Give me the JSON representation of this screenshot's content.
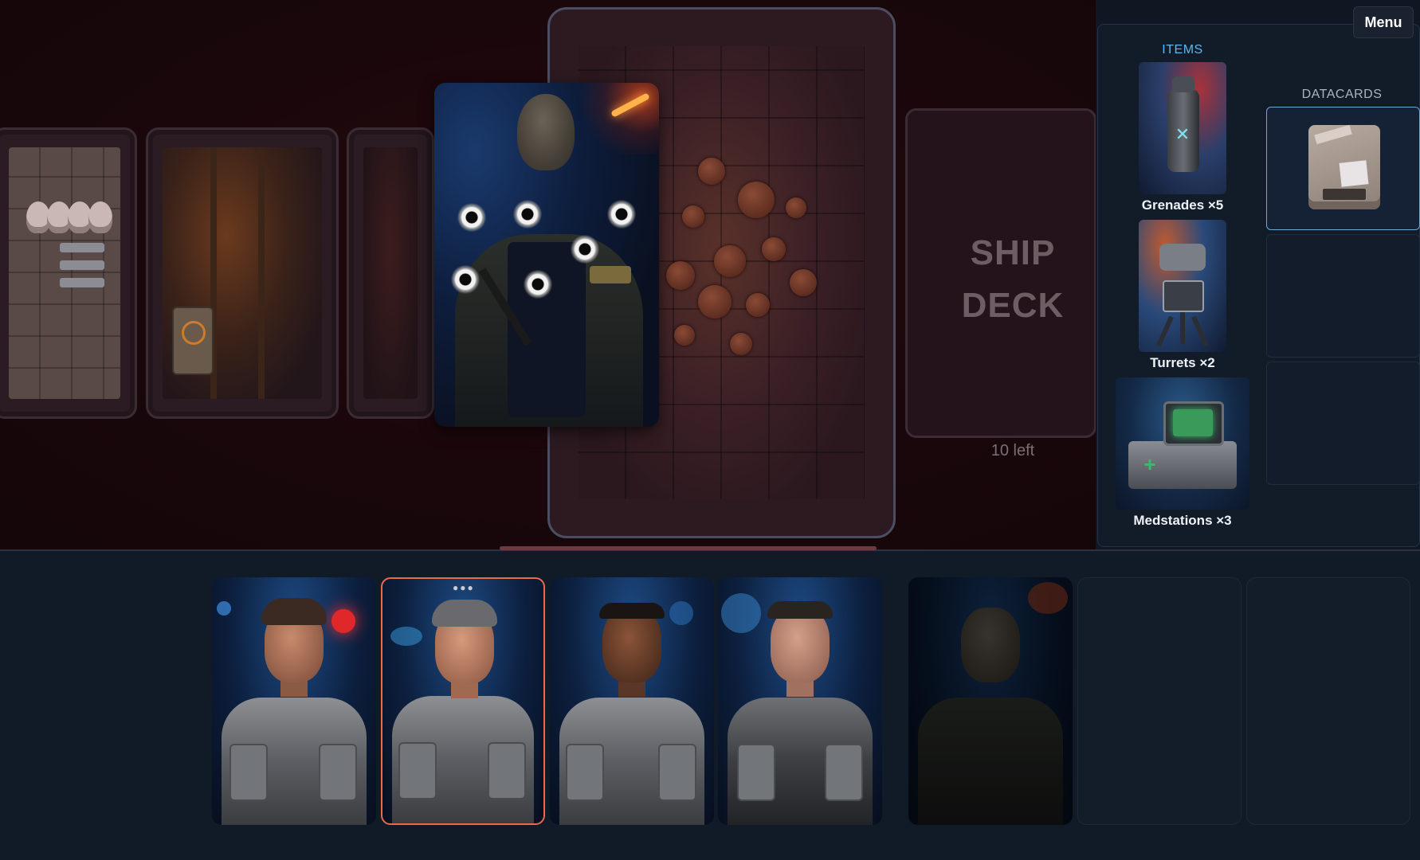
{
  "menu": {
    "label": "Menu"
  },
  "deck": {
    "title": "SHIP\nDECK",
    "remaining": "10 left"
  },
  "inventory": {
    "items_heading": "ITEMS",
    "datacards_heading": "DATACARDS",
    "items": [
      {
        "label": "Grenades ×5",
        "icon": "grenade-icon"
      },
      {
        "label": "Turrets ×2",
        "icon": "turret-icon"
      },
      {
        "label": "Medstations ×3",
        "icon": "medstation-icon"
      }
    ],
    "datacards": [
      {
        "slot": 1,
        "filled": true,
        "selected": true,
        "icon": "datacard-icon"
      },
      {
        "slot": 2,
        "filled": false
      },
      {
        "slot": 3,
        "filled": false
      }
    ]
  },
  "board": {
    "rooms": [
      "armory-room-card",
      "engine-room-card",
      "dark-room-card"
    ],
    "active_map": "alien-nest-map-card",
    "enemy": {
      "name": "synthetic-gunman-card",
      "bullet_holes": 6
    }
  },
  "hand": {
    "units": [
      {
        "name": "soldier-1",
        "selected": false
      },
      {
        "name": "soldier-2",
        "selected": true
      },
      {
        "name": "soldier-3",
        "selected": false
      },
      {
        "name": "soldier-4",
        "selected": false
      }
    ],
    "reserve": [
      {
        "name": "synthetic-gunman",
        "dimmed": true
      },
      {
        "name": "empty"
      },
      {
        "name": "empty"
      }
    ]
  },
  "colors": {
    "accent_blue": "#5db7f0",
    "selected_outline": "#e96a4c",
    "board_bg": "#1a070b",
    "panel_bg": "#121b28"
  }
}
